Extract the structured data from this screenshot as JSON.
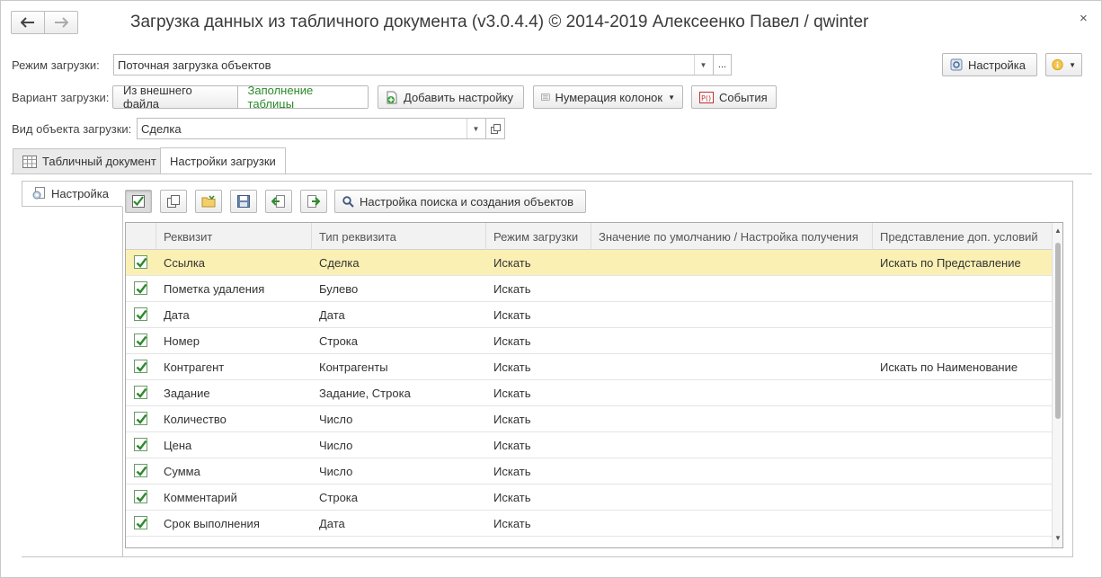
{
  "window": {
    "title": "Загрузка данных из табличного документа (v3.0.4.4) © 2014-2019 Алексеенко Павел / qwinter",
    "close_glyph": "×"
  },
  "form": {
    "mode_label": "Режим загрузки:",
    "mode_value": "Поточная загрузка объектов",
    "mode_more": "...",
    "variant_label": "Вариант загрузки:",
    "variant_options": [
      "Из внешнего файла",
      "Заполнение таблицы"
    ],
    "add_setting_button": "Добавить настройку",
    "numbering_button": "Нумерация колонок",
    "events_button": "События",
    "object_type_label": "Вид объекта загрузки:",
    "object_type_value": "Сделка",
    "settings_button": "Настройка"
  },
  "tabs": [
    {
      "label": "Табличный документ",
      "active": false
    },
    {
      "label": "Настройки загрузки",
      "active": true
    }
  ],
  "side_tab": {
    "label": "Настройка"
  },
  "toolbar": {
    "search_settings_button": "Настройка поиска и создания объектов"
  },
  "table": {
    "columns": [
      "Реквизит",
      "Тип реквизита",
      "Режим загрузки",
      "Значение по умолчанию / Настройка получения",
      "Представление доп. условий"
    ],
    "rows": [
      {
        "checked": true,
        "attr": "Ссылка",
        "type": "Сделка",
        "mode": "Искать",
        "default": "",
        "cond": "Искать по Представление",
        "selected": true
      },
      {
        "checked": true,
        "attr": "Пометка удаления",
        "type": "Булево",
        "mode": "Искать",
        "default": "",
        "cond": ""
      },
      {
        "checked": true,
        "attr": "Дата",
        "type": "Дата",
        "mode": "Искать",
        "default": "",
        "cond": ""
      },
      {
        "checked": true,
        "attr": "Номер",
        "type": "Строка",
        "mode": "Искать",
        "default": "",
        "cond": ""
      },
      {
        "checked": true,
        "attr": "Контрагент",
        "type": "Контрагенты",
        "mode": "Искать",
        "default": "",
        "cond": "Искать по Наименование"
      },
      {
        "checked": true,
        "attr": "Задание",
        "type": "Задание, Строка",
        "mode": "Искать",
        "default": "",
        "cond": ""
      },
      {
        "checked": true,
        "attr": "Количество",
        "type": "Число",
        "mode": "Искать",
        "default": "",
        "cond": ""
      },
      {
        "checked": true,
        "attr": "Цена",
        "type": "Число",
        "mode": "Искать",
        "default": "",
        "cond": ""
      },
      {
        "checked": true,
        "attr": "Сумма",
        "type": "Число",
        "mode": "Искать",
        "default": "",
        "cond": ""
      },
      {
        "checked": true,
        "attr": "Комментарий",
        "type": "Строка",
        "mode": "Искать",
        "default": "",
        "cond": ""
      },
      {
        "checked": true,
        "attr": "Срок выполнения",
        "type": "Дата",
        "mode": "Искать",
        "default": "",
        "cond": ""
      }
    ]
  },
  "colors": {
    "selected_row": "#fbf0b4",
    "check_green": "#2e8b2e",
    "variant_selected_text": "#2a8a2a"
  }
}
